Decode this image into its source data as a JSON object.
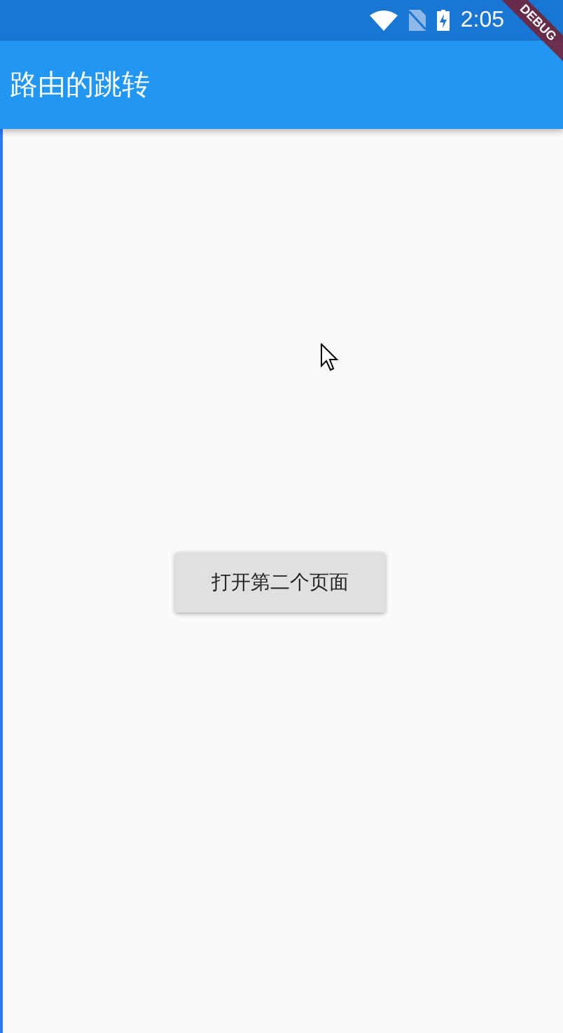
{
  "status_bar": {
    "time": "2:05"
  },
  "debug_banner": {
    "label": "DEBUG"
  },
  "app_bar": {
    "title": "路由的跳转"
  },
  "body": {
    "button": {
      "label": "打开第二个页面"
    }
  }
}
